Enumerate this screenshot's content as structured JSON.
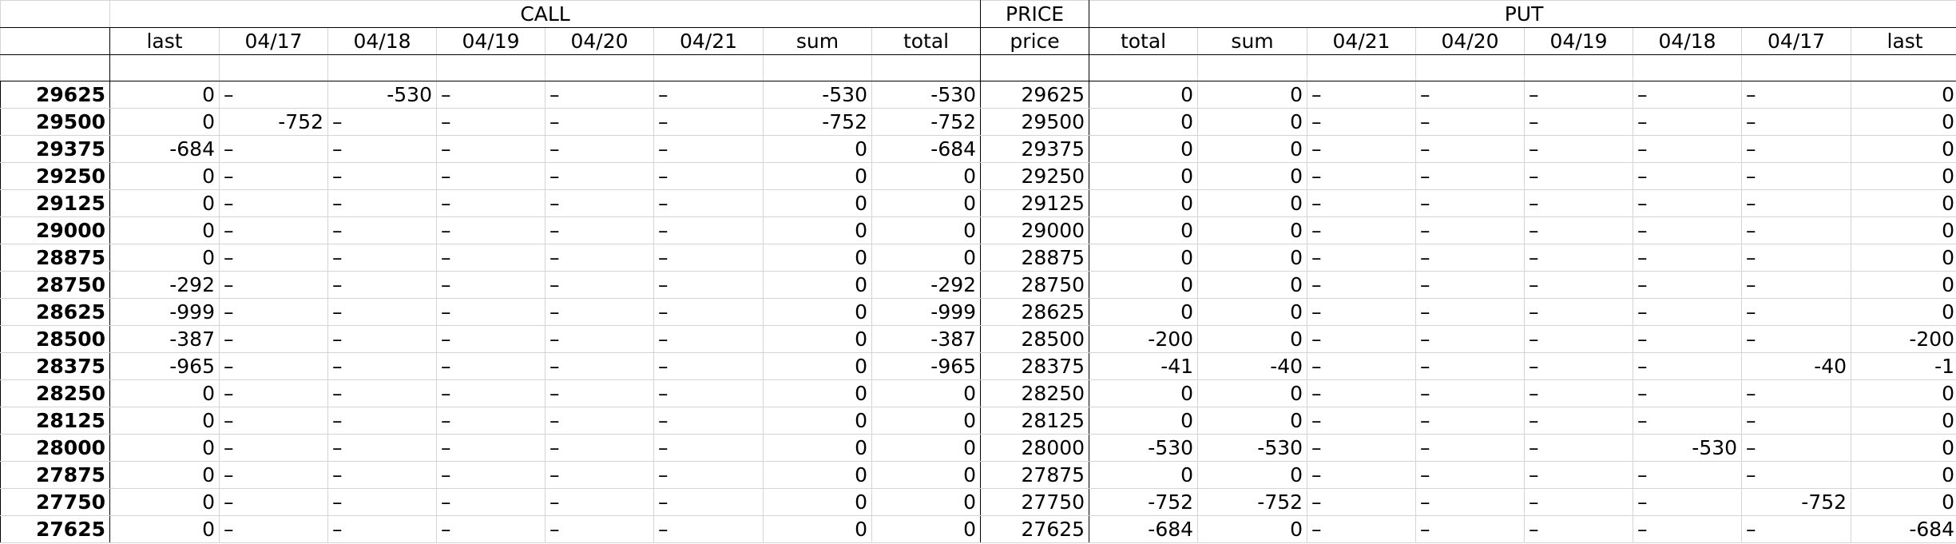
{
  "groups": {
    "call": "CALL",
    "price": "PRICE",
    "put": "PUT"
  },
  "columns": [
    "",
    "last",
    "04/17",
    "04/18",
    "04/19",
    "04/20",
    "04/21",
    "sum",
    "total",
    "price",
    "total",
    "sum",
    "04/21",
    "04/20",
    "04/19",
    "04/18",
    "04/17",
    "last"
  ],
  "rows": [
    [
      "29625",
      "0",
      "–",
      "-530",
      "–",
      "–",
      "–",
      "-530",
      "-530",
      "29625",
      "0",
      "0",
      "–",
      "–",
      "–",
      "–",
      "–",
      "0"
    ],
    [
      "29500",
      "0",
      "-752",
      "–",
      "–",
      "–",
      "–",
      "-752",
      "-752",
      "29500",
      "0",
      "0",
      "–",
      "–",
      "–",
      "–",
      "–",
      "0"
    ],
    [
      "29375",
      "-684",
      "–",
      "–",
      "–",
      "–",
      "–",
      "0",
      "-684",
      "29375",
      "0",
      "0",
      "–",
      "–",
      "–",
      "–",
      "–",
      "0"
    ],
    [
      "29250",
      "0",
      "–",
      "–",
      "–",
      "–",
      "–",
      "0",
      "0",
      "29250",
      "0",
      "0",
      "–",
      "–",
      "–",
      "–",
      "–",
      "0"
    ],
    [
      "29125",
      "0",
      "–",
      "–",
      "–",
      "–",
      "–",
      "0",
      "0",
      "29125",
      "0",
      "0",
      "–",
      "–",
      "–",
      "–",
      "–",
      "0"
    ],
    [
      "29000",
      "0",
      "–",
      "–",
      "–",
      "–",
      "–",
      "0",
      "0",
      "29000",
      "0",
      "0",
      "–",
      "–",
      "–",
      "–",
      "–",
      "0"
    ],
    [
      "28875",
      "0",
      "–",
      "–",
      "–",
      "–",
      "–",
      "0",
      "0",
      "28875",
      "0",
      "0",
      "–",
      "–",
      "–",
      "–",
      "–",
      "0"
    ],
    [
      "28750",
      "-292",
      "–",
      "–",
      "–",
      "–",
      "–",
      "0",
      "-292",
      "28750",
      "0",
      "0",
      "–",
      "–",
      "–",
      "–",
      "–",
      "0"
    ],
    [
      "28625",
      "-999",
      "–",
      "–",
      "–",
      "–",
      "–",
      "0",
      "-999",
      "28625",
      "0",
      "0",
      "–",
      "–",
      "–",
      "–",
      "–",
      "0"
    ],
    [
      "28500",
      "-387",
      "–",
      "–",
      "–",
      "–",
      "–",
      "0",
      "-387",
      "28500",
      "-200",
      "0",
      "–",
      "–",
      "–",
      "–",
      "–",
      "-200"
    ],
    [
      "28375",
      "-965",
      "–",
      "–",
      "–",
      "–",
      "–",
      "0",
      "-965",
      "28375",
      "-41",
      "-40",
      "–",
      "–",
      "–",
      "–",
      "-40",
      "-1"
    ],
    [
      "28250",
      "0",
      "–",
      "–",
      "–",
      "–",
      "–",
      "0",
      "0",
      "28250",
      "0",
      "0",
      "–",
      "–",
      "–",
      "–",
      "–",
      "0"
    ],
    [
      "28125",
      "0",
      "–",
      "–",
      "–",
      "–",
      "–",
      "0",
      "0",
      "28125",
      "0",
      "0",
      "–",
      "–",
      "–",
      "–",
      "–",
      "0"
    ],
    [
      "28000",
      "0",
      "–",
      "–",
      "–",
      "–",
      "–",
      "0",
      "0",
      "28000",
      "-530",
      "-530",
      "–",
      "–",
      "–",
      "-530",
      "–",
      "0"
    ],
    [
      "27875",
      "0",
      "–",
      "–",
      "–",
      "–",
      "–",
      "0",
      "0",
      "27875",
      "0",
      "0",
      "–",
      "–",
      "–",
      "–",
      "–",
      "0"
    ],
    [
      "27750",
      "0",
      "–",
      "–",
      "–",
      "–",
      "–",
      "0",
      "0",
      "27750",
      "-752",
      "-752",
      "–",
      "–",
      "–",
      "–",
      "-752",
      "0"
    ],
    [
      "27625",
      "0",
      "–",
      "–",
      "–",
      "–",
      "–",
      "0",
      "0",
      "27625",
      "-684",
      "0",
      "–",
      "–",
      "–",
      "–",
      "–",
      "-684"
    ]
  ]
}
